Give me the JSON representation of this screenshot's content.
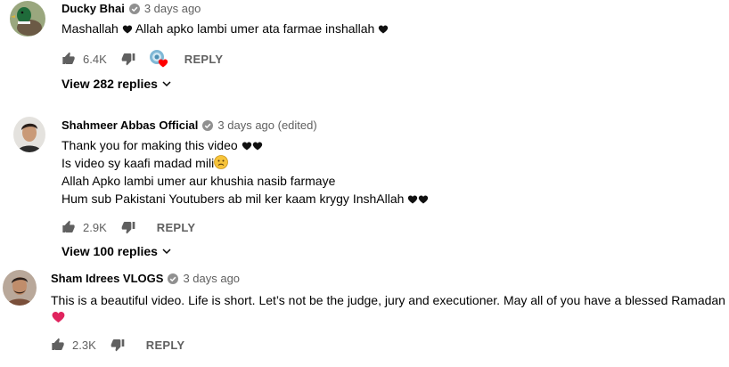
{
  "comments": [
    {
      "author": "Ducky Bhai",
      "time": "3 days ago",
      "lines": [
        "Mashallah",
        "Allah apko lambi umer ata farmae inshallah"
      ],
      "likes": "6.4K",
      "reply_label": "REPLY",
      "view_replies": "View 282 replies",
      "hearted_by_creator": true
    },
    {
      "author": "Shahmeer Abbas Official",
      "time": "3 days ago (edited)",
      "lines": [
        "Thank you for making this video",
        "Is video sy kaafi madad mili",
        "Allah Apko lambi umer aur khushia nasib farmaye",
        "Hum sub Pakistani Youtubers ab mil ker kaam krygy InshAllah"
      ],
      "likes": "2.9K",
      "reply_label": "REPLY",
      "view_replies": "View 100 replies"
    },
    {
      "author": "Sham Idrees VLOGS",
      "time": "3 days ago",
      "lines": [
        "This is a beautiful video. Life is short. Let’s not be the judge, jury and executioner. May all of you have a blessed Ramadan"
      ],
      "likes": "2.3K",
      "reply_label": "REPLY"
    }
  ],
  "icons": {
    "verified": "verified-check-icon",
    "like": "thumbs-up-icon",
    "dislike": "thumbs-down-icon",
    "heart": "heart-icon",
    "expand": "chevron-down-icon",
    "emoji": "sad-face-emoji"
  },
  "colors": {
    "red_heart": "#e0245e",
    "meta": "#606060",
    "text": "#030303"
  }
}
